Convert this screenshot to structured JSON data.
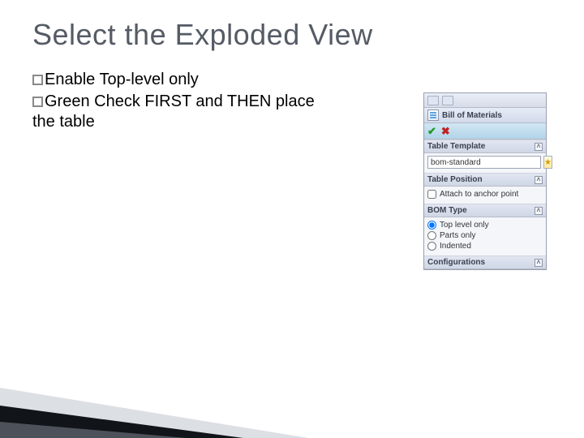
{
  "title": "Select the Exploded View",
  "bullets": [
    "Enable Top-level only",
    "Green Check FIRST and THEN place the table"
  ],
  "panel": {
    "header": "Bill of Materials",
    "sections": {
      "template": {
        "title": "Table Template",
        "value": "bom-standard"
      },
      "position": {
        "title": "Table Position",
        "checkbox_label": "Attach to anchor point",
        "checkbox_checked": false
      },
      "bomtype": {
        "title": "BOM Type",
        "options": [
          {
            "label": "Top level only",
            "checked": true
          },
          {
            "label": "Parts only",
            "checked": false
          },
          {
            "label": "Indented",
            "checked": false
          }
        ]
      },
      "configs": {
        "title": "Configurations"
      }
    }
  }
}
